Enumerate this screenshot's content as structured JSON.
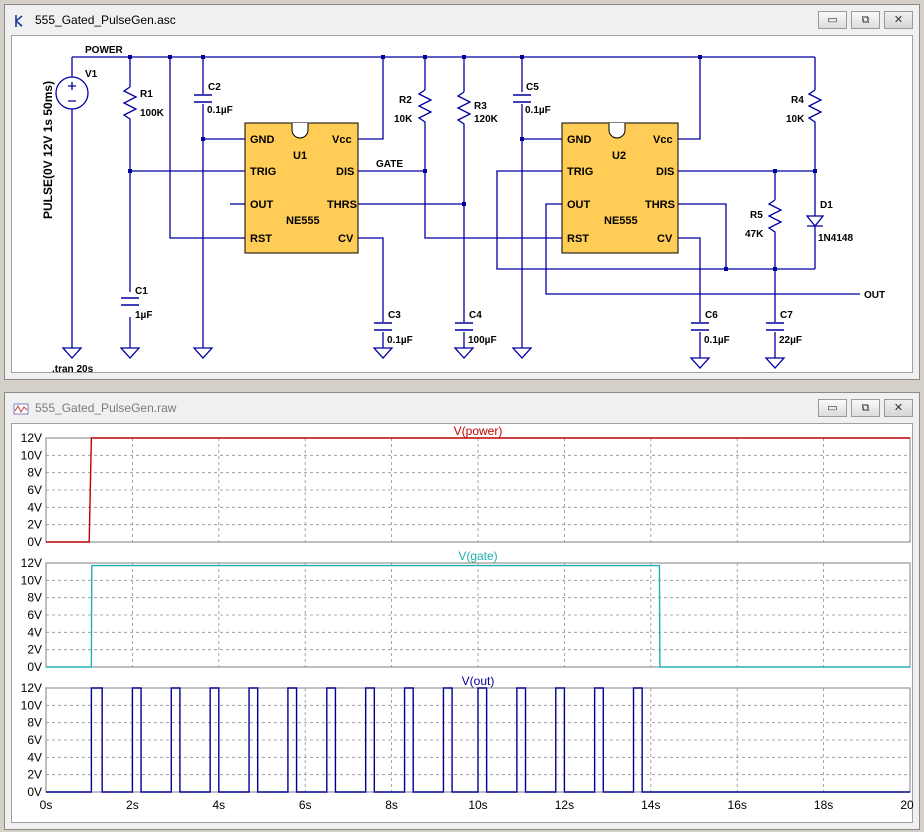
{
  "schematic_window": {
    "title": "555_Gated_PulseGen.asc",
    "buttons": {
      "minimize": "▭",
      "restore": "⧉",
      "close": "✕"
    }
  },
  "waveform_window": {
    "title": "555_Gated_PulseGen.raw",
    "buttons": {
      "minimize": "▭",
      "restore": "⧉",
      "close": "✕"
    }
  },
  "schematic": {
    "net_power": "POWER",
    "net_gate": "GATE",
    "net_out": "OUT",
    "v1_name": "V1",
    "v1_value": "PULSE(0V 12V 1s 50ms)",
    "directive": ".tran 20s",
    "r1": {
      "name": "R1",
      "value": "100K"
    },
    "r2": {
      "name": "R2",
      "value": "10K"
    },
    "r3": {
      "name": "R3",
      "value": "120K"
    },
    "r4": {
      "name": "R4",
      "value": "10K"
    },
    "r5": {
      "name": "R5",
      "value": "47K"
    },
    "c1": {
      "name": "C1",
      "value": "1µF"
    },
    "c2": {
      "name": "C2",
      "value": "0.1µF"
    },
    "c3": {
      "name": "C3",
      "value": "0.1µF"
    },
    "c4": {
      "name": "C4",
      "value": "100µF"
    },
    "c5": {
      "name": "C5",
      "value": "0.1µF"
    },
    "c6": {
      "name": "C6",
      "value": "0.1µF"
    },
    "c7": {
      "name": "C7",
      "value": "22µF"
    },
    "d1": {
      "name": "D1",
      "value": "1N4148"
    },
    "u1": {
      "name": "U1",
      "part": "NE555"
    },
    "u2": {
      "name": "U2",
      "part": "NE555"
    },
    "pins": {
      "gnd": "GND",
      "vcc": "Vcc",
      "trig": "TRIG",
      "dis": "DIS",
      "out": "OUT",
      "thrs": "THRS",
      "rst": "RST",
      "cv": "CV"
    }
  },
  "chart_data": [
    {
      "type": "line",
      "title": "V(power)",
      "color": "#c00000",
      "x": [
        0,
        1.0,
        1.05,
        20
      ],
      "y": [
        0,
        0,
        12,
        12
      ],
      "ylim": [
        0,
        12
      ],
      "yticks": [
        "12V",
        "10V",
        "8V",
        "6V",
        "4V",
        "2V",
        "0V"
      ],
      "grid": true
    },
    {
      "type": "line",
      "title": "V(gate)",
      "color": "#20b0b0",
      "x": [
        0,
        1.05,
        1.06,
        14.2,
        14.21,
        20
      ],
      "y": [
        0,
        0,
        11.7,
        11.7,
        0,
        0
      ],
      "ylim": [
        0,
        12
      ],
      "yticks": [
        "12V",
        "10V",
        "8V",
        "6V",
        "4V",
        "2V",
        "0V"
      ],
      "grid": true
    },
    {
      "type": "line",
      "title": "V(out)",
      "color": "#000090",
      "pulses": [
        [
          1.05,
          1.3
        ],
        [
          2.0,
          2.2
        ],
        [
          2.9,
          3.1
        ],
        [
          3.8,
          4.0
        ],
        [
          4.7,
          4.9
        ],
        [
          5.6,
          5.8
        ],
        [
          6.5,
          6.7
        ],
        [
          7.4,
          7.6
        ],
        [
          8.3,
          8.5
        ],
        [
          9.2,
          9.4
        ],
        [
          10.0,
          10.2
        ],
        [
          10.9,
          11.1
        ],
        [
          11.8,
          12.0
        ],
        [
          12.7,
          12.9
        ],
        [
          13.6,
          13.8
        ]
      ],
      "high": 12,
      "ylim": [
        0,
        12
      ],
      "yticks": [
        "12V",
        "10V",
        "8V",
        "6V",
        "4V",
        "2V",
        "0V"
      ],
      "xticks": [
        "0s",
        "2s",
        "4s",
        "6s",
        "8s",
        "10s",
        "12s",
        "14s",
        "16s",
        "18s",
        "20s"
      ],
      "xlim": [
        0,
        20
      ],
      "grid": true
    }
  ]
}
